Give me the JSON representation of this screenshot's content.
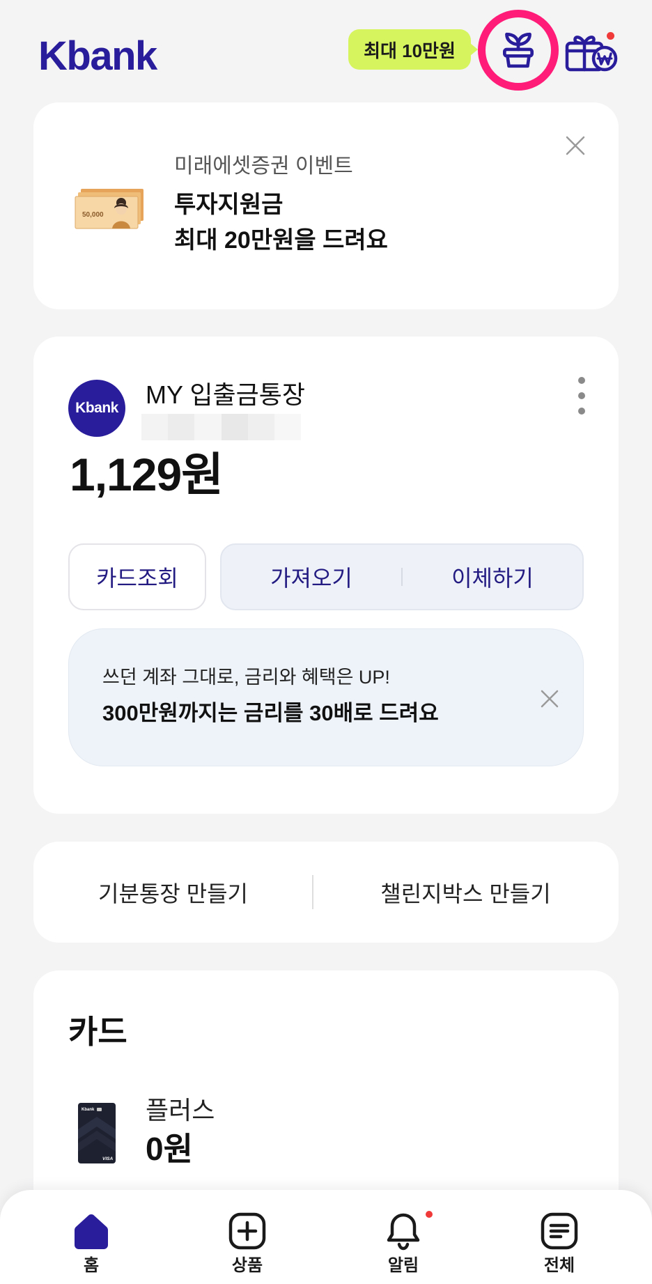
{
  "header": {
    "logo": "Kbank",
    "promo_badge": "최대 10만원",
    "icons": {
      "grow": "sprout-pot-icon",
      "gift": "gift-won-icon"
    },
    "gift_has_new": true
  },
  "event_banner": {
    "image_banknote_text": "50,000",
    "subtitle": "미래에셋증권 이벤트",
    "title_line1": "투자지원금",
    "title_line2": "최대 20만원을 드려요",
    "close_icon": "close-icon"
  },
  "account": {
    "logo": "Kbank",
    "name": "MY 입출금통장",
    "balance": "1,129원",
    "menu_icon": "kebab-menu-icon",
    "actions": {
      "card_lookup": "카드조회",
      "import": "가져오기",
      "transfer": "이체하기"
    },
    "promo": {
      "line1": "쓰던 계좌 그대로, 금리와 혜택은 UP!",
      "line2": "300만원까지는 금리를 30배로 드려요",
      "close_icon": "close-icon"
    }
  },
  "quick_links": [
    {
      "label": "기분통장 만들기"
    },
    {
      "label": "챌린지박스 만들기"
    }
  ],
  "cards": {
    "title": "카드",
    "items": [
      {
        "name": "플러스",
        "amount": "0원",
        "card_logo": "Kbank",
        "card_network": "VISA"
      }
    ]
  },
  "bottom_nav": [
    {
      "label": "홈",
      "icon": "home-icon",
      "active": true
    },
    {
      "label": "상품",
      "icon": "plus-square-icon",
      "active": false
    },
    {
      "label": "알림",
      "icon": "bell-icon",
      "active": false,
      "has_new": true
    },
    {
      "label": "전체",
      "icon": "menu-list-icon",
      "active": false
    }
  ],
  "colors": {
    "brand": "#2a1d9c",
    "accent_pink": "#ff1b78",
    "badge_lime": "#d6f45e",
    "notification_red": "#f03a3a",
    "page_bg": "#f4f4f5",
    "action_bg": "#eef2f8"
  }
}
